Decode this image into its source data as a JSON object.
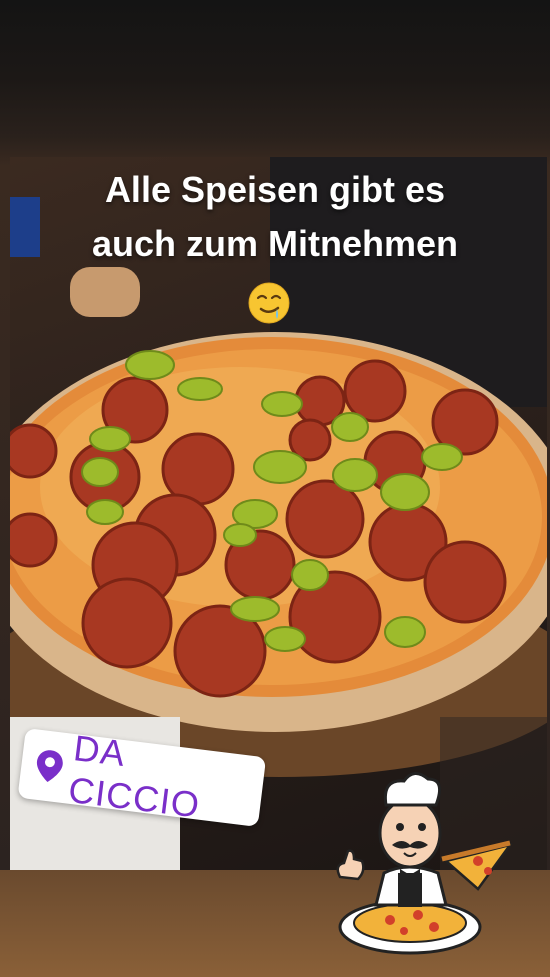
{
  "caption": {
    "line1": "Alle Speisen gibt es",
    "line2": "auch zum Mitnehmen",
    "emoji": "drooling-face-icon"
  },
  "location_sticker": {
    "icon": "location-pin-icon",
    "label": "DA CICCIO",
    "accent_color": "#7a2fc9"
  },
  "illustration": "chef-with-pizza-icon"
}
